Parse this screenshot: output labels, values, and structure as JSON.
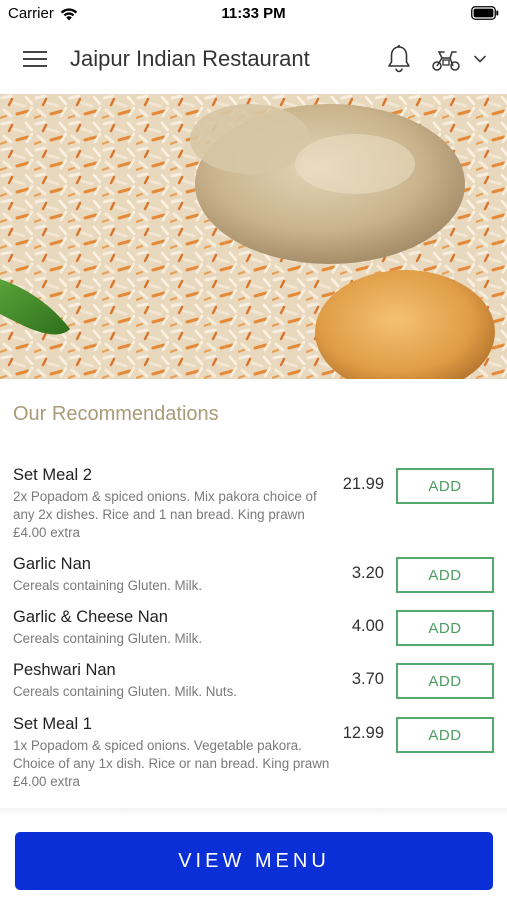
{
  "status_bar": {
    "carrier": "Carrier",
    "time": "11:33 PM"
  },
  "header": {
    "title": "Jaipur Indian Restaurant",
    "icons": [
      "menu-icon",
      "bell-icon",
      "delivery-scooter-icon",
      "chevron-down-icon"
    ]
  },
  "hero": {
    "image": "biryani-photo"
  },
  "recommendations": {
    "title": "Our Recommendations",
    "items": [
      {
        "name": "Set Meal 2",
        "description": "2x Popadom & spiced onions. Mix pakora choice of any 2x dishes. Rice and 1 nan bread. King prawn £4.00 extra",
        "price": "21.99",
        "button": "ADD"
      },
      {
        "name": "Garlic Nan",
        "description": "Cereals containing Gluten. Milk.",
        "price": "3.20",
        "button": "ADD"
      },
      {
        "name": "Garlic & Cheese Nan",
        "description": "Cereals containing Gluten. Milk.",
        "price": "4.00",
        "button": "ADD"
      },
      {
        "name": "Peshwari Nan",
        "description": "Cereals containing Gluten. Milk. Nuts.",
        "price": "3.70",
        "button": "ADD"
      },
      {
        "name": "Set Meal 1",
        "description": "1x Popadom & spiced onions. Vegetable pakora. Choice of any 1x dish. Rice or nan bread. King prawn £4.00 extra",
        "price": "12.99",
        "button": "ADD"
      }
    ]
  },
  "footer": {
    "view_menu_label": "VIEW MENU"
  },
  "colors": {
    "accent_green": "#4c9c62",
    "primary_blue": "#0a2fd6",
    "section_title": "#a99a78"
  }
}
